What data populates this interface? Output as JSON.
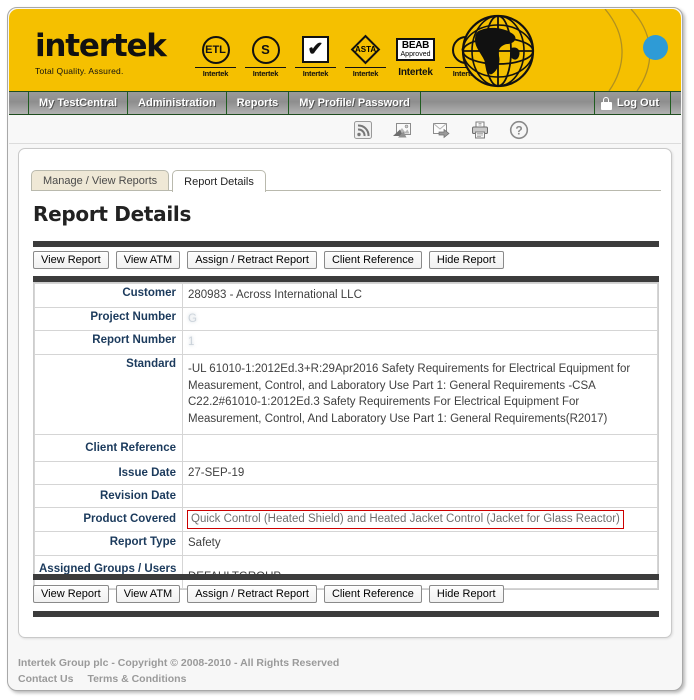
{
  "brand": {
    "wordmark": "intertek",
    "tagline": "Total Quality. Assured.",
    "yellow": "#f5c000",
    "marks": [
      {
        "name": "etl-mark",
        "symbol": "ETL",
        "caption": "Intertek"
      },
      {
        "name": "semko-s-mark",
        "symbol": "S",
        "caption": "Intertek"
      },
      {
        "name": "warnock-hersey-check-mark",
        "symbol": "✔",
        "caption": "Intertek"
      },
      {
        "name": "asta-diamond-mark",
        "symbol": "ASTA",
        "caption": "Intertek"
      },
      {
        "name": "beab-approved-mark",
        "symbol": "BEAB",
        "symbol_sub": "Approved",
        "caption": "Intertek"
      },
      {
        "name": "kema-mark",
        "symbol": "◠",
        "caption": "Intertek"
      }
    ]
  },
  "nav": {
    "items": [
      {
        "name": "my-testcentral",
        "label": "My TestCentral"
      },
      {
        "name": "administration",
        "label": "Administration"
      },
      {
        "name": "reports",
        "label": "Reports"
      },
      {
        "name": "my-profile-password",
        "label": "My Profile/ Password"
      }
    ],
    "logout_label": "Log Out",
    "logout_icon": "lock-icon"
  },
  "toolbar": {
    "icons": [
      {
        "name": "rss-feed-icon",
        "title": "RSS Feed"
      },
      {
        "name": "export-image-icon",
        "title": "Export Image"
      },
      {
        "name": "export-arrow-icon",
        "title": "Export"
      },
      {
        "name": "printer-icon",
        "title": "Print"
      },
      {
        "name": "help-icon",
        "title": "Help"
      }
    ]
  },
  "tabs": [
    {
      "name": "tab-manage-view-reports",
      "label": "Manage / View Reports",
      "active": false
    },
    {
      "name": "tab-report-details",
      "label": "Report Details",
      "active": true
    }
  ],
  "page": {
    "title": "Report Details"
  },
  "action_buttons": [
    {
      "name": "view-report-button",
      "label": "View Report"
    },
    {
      "name": "view-atm-button",
      "label": "View ATM"
    },
    {
      "name": "assign-retract-report-button",
      "label": "Assign / Retract Report"
    },
    {
      "name": "client-reference-button",
      "label": "Client Reference"
    },
    {
      "name": "hide-report-button",
      "label": "Hide Report"
    }
  ],
  "details": [
    {
      "label": "Customer",
      "value": "280983 - Across International LLC",
      "state": "normal"
    },
    {
      "label": "Project Number",
      "value": "G",
      "state": "blurred"
    },
    {
      "label": "Report Number",
      "value": "1",
      "state": "blurred"
    },
    {
      "label": "Standard",
      "value": "-UL 61010-1:2012Ed.3+R:29Apr2016 Safety Requirements for Electrical Equipment for Measurement, Control, and Laboratory Use Part 1: General Requirements -CSA C22.2#61010-1:2012Ed.3 Safety Requirements For Electrical Equipment For Measurement, Control, And Laboratory Use Part 1: General Requirements(R2017)",
      "state": "normal"
    },
    {
      "label": "Client Reference",
      "value": "",
      "state": "normal"
    },
    {
      "label": "Issue Date",
      "value": "27-SEP-19",
      "state": "normal"
    },
    {
      "label": "Revision Date",
      "value": "",
      "state": "normal"
    },
    {
      "label": "Product Covered",
      "value": "Quick Control (Heated Shield) and Heated Jacket Control (Jacket for Glass Reactor)",
      "state": "highlight"
    },
    {
      "label": "Report Type",
      "value": "Safety",
      "state": "normal"
    },
    {
      "label": "Assigned Groups / Users",
      "value": "DEFAULTGROUP",
      "state": "normal"
    }
  ],
  "highlight_color": "#cc0000",
  "footer": {
    "copyright": "Intertek Group plc - Copyright © 2008-2010 - All Rights Reserved",
    "links": [
      {
        "name": "contact-us-link",
        "label": "Contact Us"
      },
      {
        "name": "terms-conditions-link",
        "label": "Terms & Conditions"
      }
    ]
  }
}
